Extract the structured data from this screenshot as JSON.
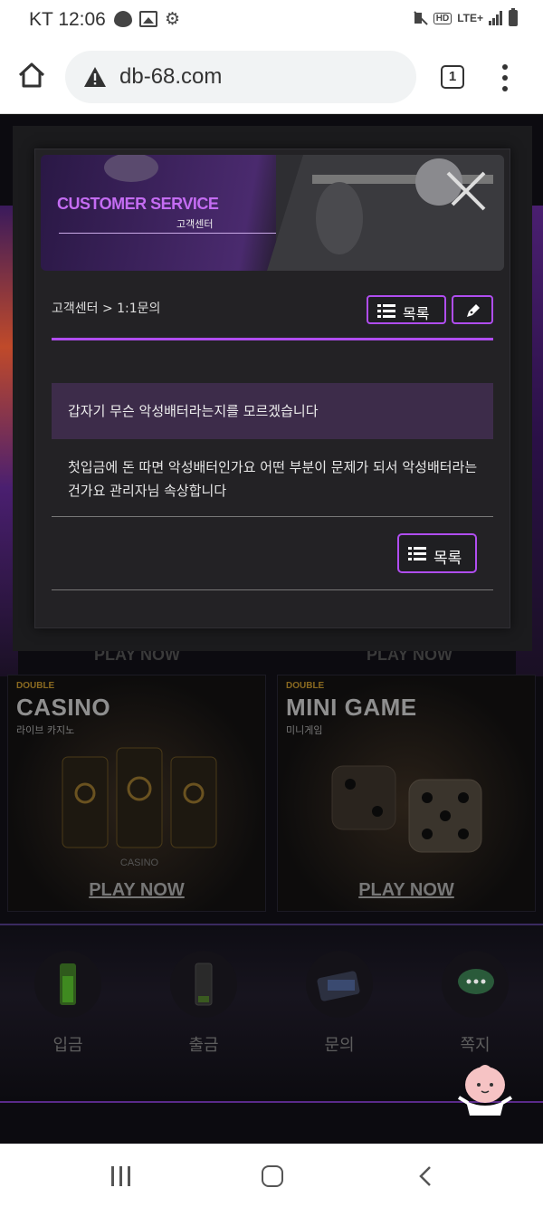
{
  "status_bar": {
    "carrier": "KT",
    "time": "12:06",
    "hd": "HD",
    "network": "LTE+"
  },
  "browser": {
    "url": "db-68.com",
    "tab_count": "1"
  },
  "modal": {
    "banner_title": "CUSTOMER SERVICE",
    "banner_subtitle": "고객센터",
    "breadcrumb": "고객센터 > 1:1문의",
    "list_button": "목록",
    "subject": "갑자기 무슨 악성배터라는지를 모르겠습니다",
    "content": "첫입금에 돈 따면 악성배터인가요 어떤 부분이 문제가 되서 악성배터라는건가요 관리자님 속상합니다",
    "list_button_bottom": "목록"
  },
  "background_page": {
    "games": [
      {
        "badge": "DOUBLE",
        "title": "CASINO",
        "subtitle": "라이브 카지노",
        "play": "PLAY NOW"
      },
      {
        "badge": "DOUBLE",
        "title": "MINI GAME",
        "subtitle": "미니게임",
        "play": "PLAY NOW"
      }
    ],
    "quick_menu": [
      {
        "label": "입금",
        "icon": "battery-full-icon"
      },
      {
        "label": "출금",
        "icon": "battery-empty-icon"
      },
      {
        "label": "문의",
        "icon": "card-icon"
      },
      {
        "label": "쪽지",
        "icon": "chat-bubble-icon"
      }
    ]
  },
  "colors": {
    "accent": "#b04df0",
    "subject_bg": "#3d2c4a",
    "modal_bg": "#232225",
    "banner_title": "#c46cf2"
  }
}
